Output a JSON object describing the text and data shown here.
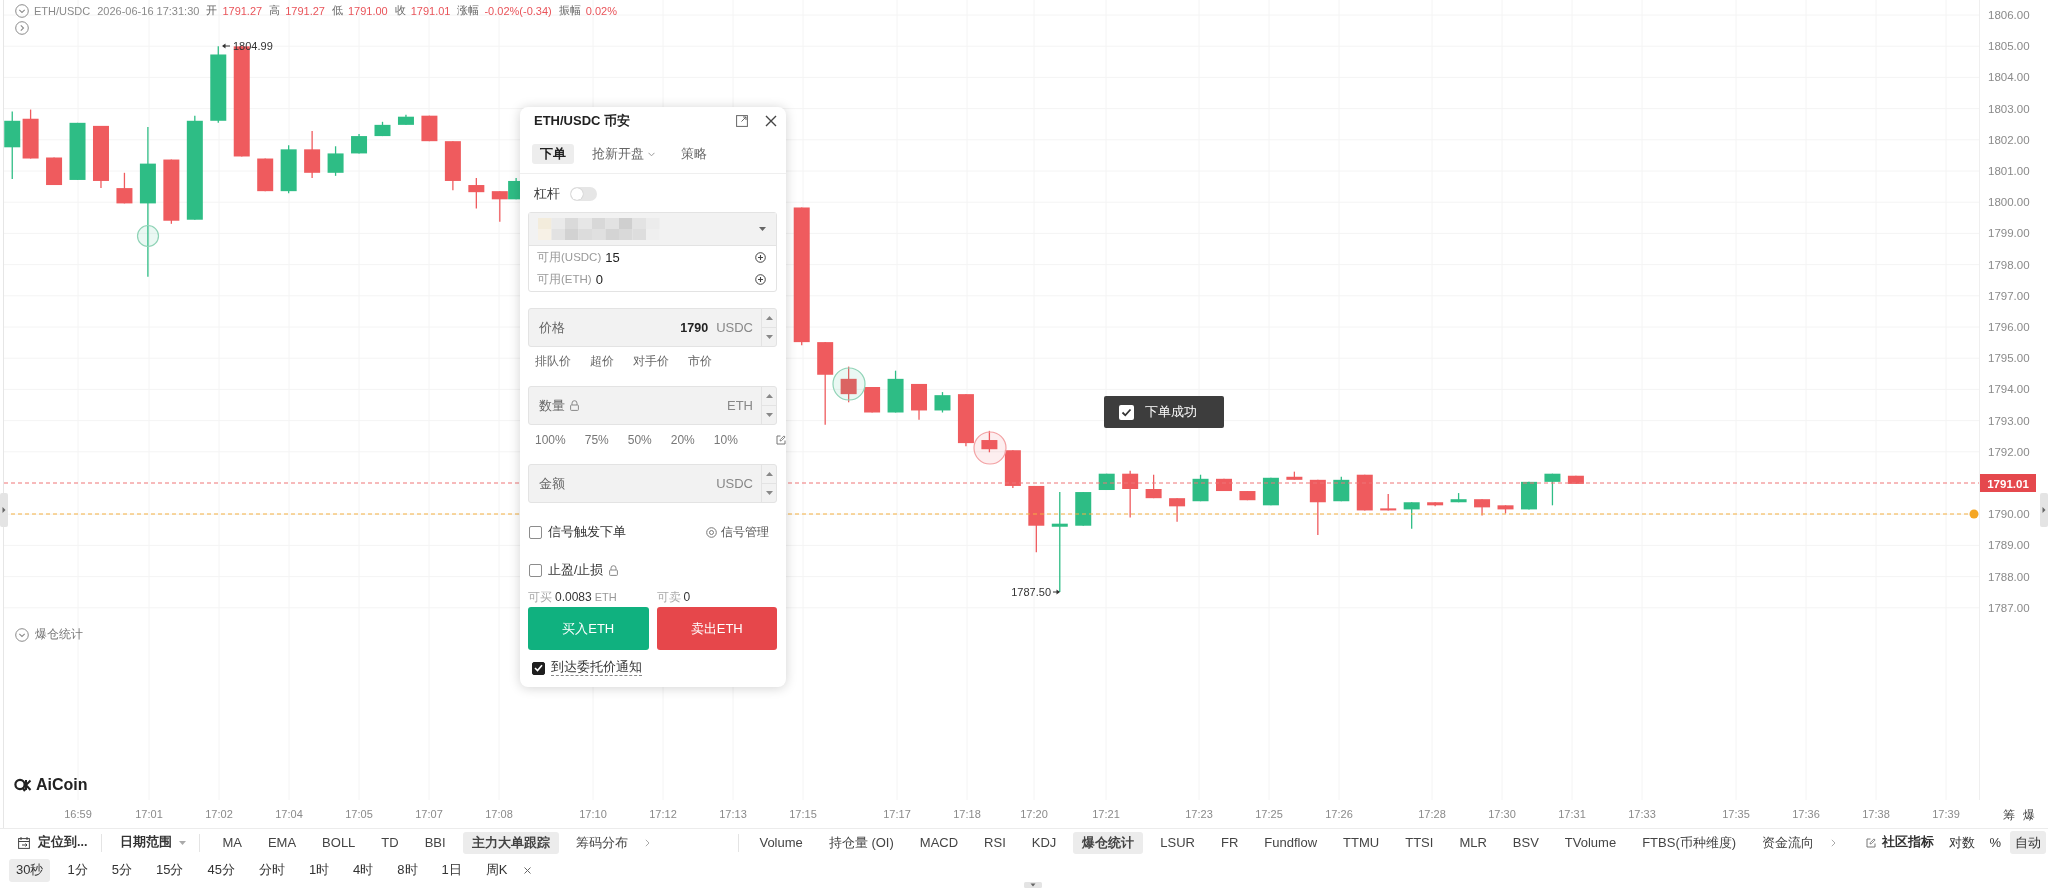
{
  "legend": {
    "symbol": "ETH/USDC",
    "time": "2026-06-16 17:31:30",
    "fields": [
      {
        "label": "开",
        "value": "1791.27"
      },
      {
        "label": "高",
        "value": "1791.27"
      },
      {
        "label": "低",
        "value": "1791.00"
      },
      {
        "label": "收",
        "value": "1791.01"
      },
      {
        "label": "涨幅",
        "value": "-0.02%(-0.34)"
      },
      {
        "label": "振幅",
        "value": "0.02%"
      }
    ]
  },
  "chart": {
    "price_ticks": [
      "1806.00",
      "1805.00",
      "1804.00",
      "1803.00",
      "1802.00",
      "1801.00",
      "1800.00",
      "1799.00",
      "1798.00",
      "1797.00",
      "1796.00",
      "1795.00",
      "1794.00",
      "1793.00",
      "1792.00",
      "1790.00",
      "1789.00",
      "1788.00",
      "1787.00"
    ],
    "last_price": "1791.01",
    "high_label": "1804.99",
    "low_label": "1787.50",
    "time_ticks": [
      "16:59",
      "17:01",
      "17:02",
      "17:04",
      "17:05",
      "17:07",
      "17:08",
      "17:10",
      "17:12",
      "17:13",
      "17:15",
      "17:17",
      "17:18",
      "17:20",
      "17:21",
      "17:23",
      "17:25",
      "17:26",
      "17:28",
      "17:30",
      "17:31",
      "17:33",
      "17:35",
      "17:36",
      "17:38",
      "17:39"
    ],
    "corner_labels": [
      "筹",
      "爆"
    ],
    "sub_panel_title": "爆仓统计",
    "logo": "AiCoin"
  },
  "order_panel": {
    "title": "ETH/USDC 币安",
    "tabs": [
      {
        "label": "下单",
        "selected": true,
        "kind": "tab"
      },
      {
        "label": "抢新开盘",
        "selected": false,
        "kind": "menu"
      },
      {
        "label": "策略",
        "selected": false,
        "kind": "tab"
      }
    ],
    "leverage": {
      "label": "杠杆",
      "on": false
    },
    "balances": [
      {
        "label": "可用(USDC)",
        "value": "15"
      },
      {
        "label": "可用(ETH)",
        "value": "0"
      }
    ],
    "price": {
      "label": "价格",
      "value": "1790",
      "unit": "USDC"
    },
    "price_options": [
      "排队价",
      "超价",
      "对手价",
      "市价"
    ],
    "quantity": {
      "label": "数量",
      "unit": "ETH"
    },
    "percent_options": [
      "100%",
      "75%",
      "50%",
      "20%",
      "10%"
    ],
    "amount": {
      "label": "金额",
      "unit": "USDC"
    },
    "signal": {
      "label": "信号触发下单",
      "checked": false,
      "manage": "信号管理"
    },
    "tp_sl": {
      "label": "止盈/止损",
      "checked": false
    },
    "buyable": {
      "label": "可买",
      "value": "0.0083",
      "unit": "ETH"
    },
    "sellable": {
      "label": "可卖",
      "value": "0"
    },
    "buy_button": "买入ETH",
    "sell_button": "卖出ETH",
    "notify": {
      "label": "到达委托价通知",
      "checked": true
    }
  },
  "toast": {
    "text": "下单成功"
  },
  "toolbar": {
    "locate": "定位到...",
    "date_range": "日期范围",
    "main_indicators": [
      {
        "label": "MA",
        "selected": false
      },
      {
        "label": "EMA",
        "selected": false
      },
      {
        "label": "BOLL",
        "selected": false
      },
      {
        "label": "TD",
        "selected": false
      },
      {
        "label": "BBI",
        "selected": false
      },
      {
        "label": "主力大单跟踪",
        "selected": true
      },
      {
        "label": "筹码分布",
        "selected": false
      }
    ],
    "sub_indicators": [
      {
        "label": "Volume",
        "selected": false
      },
      {
        "label": "持仓量 (OI)",
        "selected": false
      },
      {
        "label": "MACD",
        "selected": false
      },
      {
        "label": "RSI",
        "selected": false
      },
      {
        "label": "KDJ",
        "selected": false
      },
      {
        "label": "爆仓统计",
        "selected": true
      },
      {
        "label": "LSUR",
        "selected": false
      },
      {
        "label": "FR",
        "selected": false
      },
      {
        "label": "Fundflow",
        "selected": false
      },
      {
        "label": "TTMU",
        "selected": false
      },
      {
        "label": "TTSI",
        "selected": false
      },
      {
        "label": "MLR",
        "selected": false
      },
      {
        "label": "BSV",
        "selected": false
      },
      {
        "label": "TVolume",
        "selected": false
      },
      {
        "label": "FTBS(币种维度)",
        "selected": false
      },
      {
        "label": "资金流向",
        "selected": false
      }
    ],
    "community": "社区指标",
    "scale_options": [
      {
        "label": "对数",
        "selected": false
      },
      {
        "label": "%",
        "selected": false
      },
      {
        "label": "自动",
        "selected": true
      }
    ]
  },
  "periods": [
    {
      "label": "30秒",
      "selected": true
    },
    {
      "label": "1分",
      "selected": false
    },
    {
      "label": "5分",
      "selected": false
    },
    {
      "label": "15分",
      "selected": false
    },
    {
      "label": "45分",
      "selected": false
    },
    {
      "label": "分时",
      "selected": false
    },
    {
      "label": "1时",
      "selected": false
    },
    {
      "label": "4时",
      "selected": false
    },
    {
      "label": "8时",
      "selected": false
    },
    {
      "label": "1日",
      "selected": false
    },
    {
      "label": "周K",
      "selected": false
    }
  ]
}
